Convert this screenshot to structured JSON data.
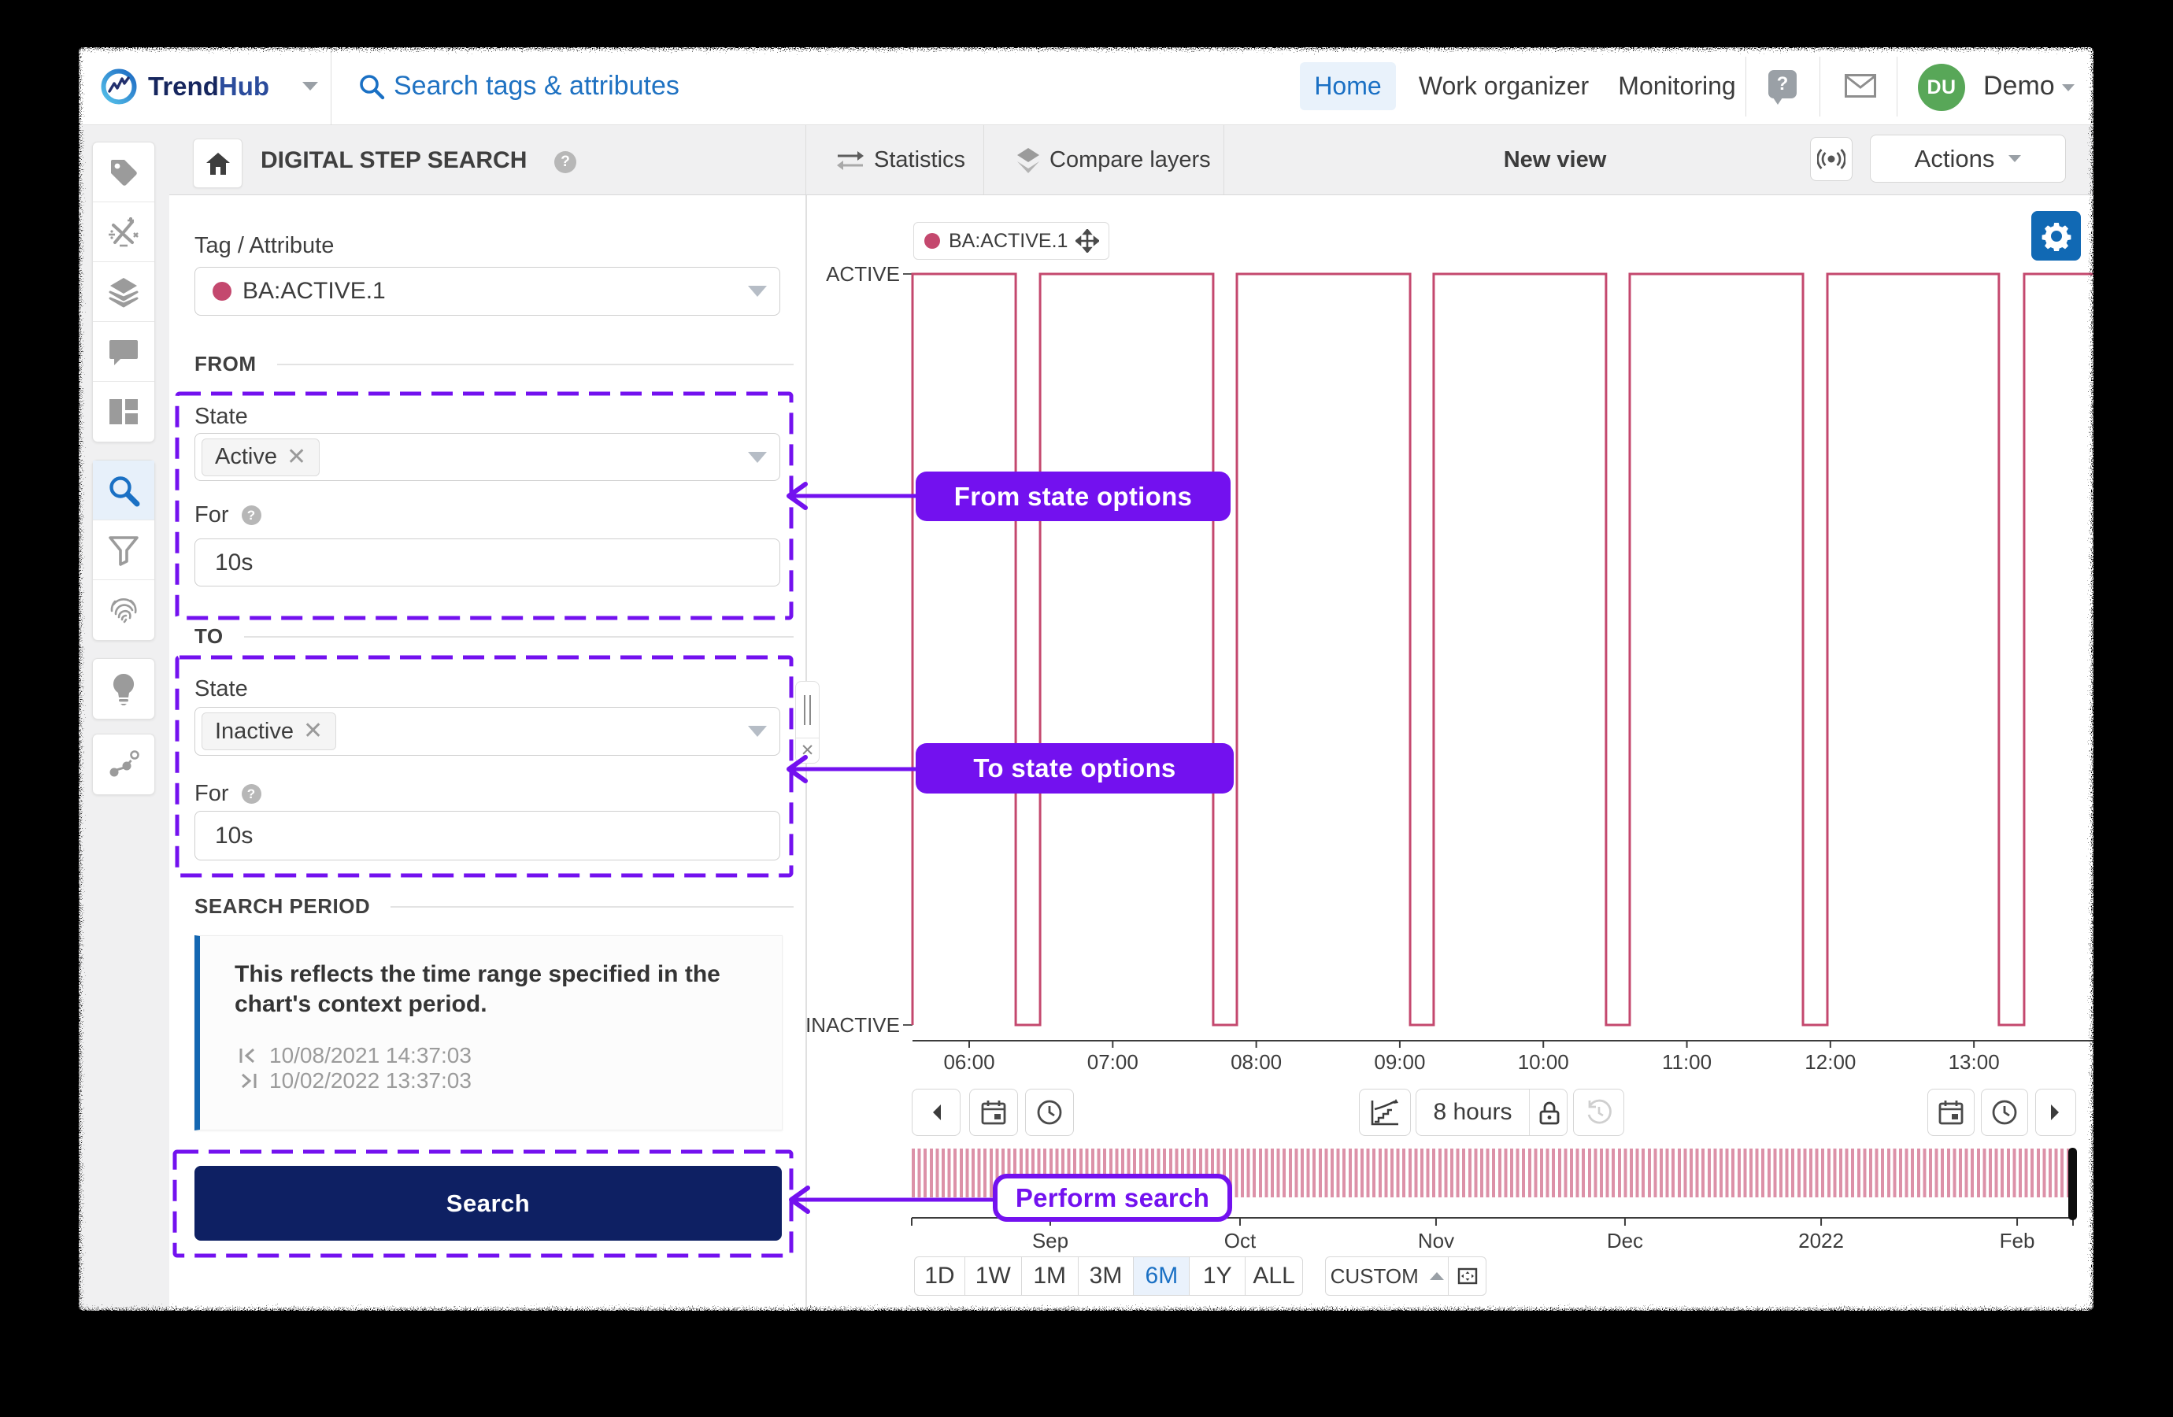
{
  "header": {
    "brand": {
      "bold": "Trend",
      "light": "Hub"
    },
    "search_placeholder": "Search tags & attributes",
    "nav": [
      {
        "label": "Home",
        "active": true
      },
      {
        "label": "Work organizer",
        "active": false
      },
      {
        "label": "Monitoring",
        "active": false
      }
    ],
    "user": {
      "initials": "DU",
      "name": "Demo"
    }
  },
  "toolbar": {
    "title": "DIGITAL STEP SEARCH",
    "statistics_label": "Statistics",
    "compare_layers_label": "Compare layers",
    "view_name": "New view",
    "actions_label": "Actions"
  },
  "sidebar": {
    "items": [
      {
        "icon": "tag"
      },
      {
        "icon": "calculation"
      },
      {
        "icon": "layers"
      },
      {
        "icon": "comment"
      },
      {
        "icon": "dashboard"
      },
      {
        "icon": "search",
        "active": true
      },
      {
        "icon": "filter"
      },
      {
        "icon": "fingerprint"
      },
      {
        "icon": "recommendation"
      },
      {
        "icon": "context-tree"
      }
    ]
  },
  "panel": {
    "tag_attribute": {
      "label": "Tag / Attribute",
      "value": "BA:ACTIVE.1",
      "color": "#c4486e"
    },
    "from": {
      "section": "FROM",
      "state_label": "State",
      "state_value": "Active",
      "for_label": "For",
      "for_value": "10s"
    },
    "to": {
      "section": "TO",
      "state_label": "State",
      "state_value": "Inactive",
      "for_label": "For",
      "for_value": "10s"
    },
    "search_period": {
      "section": "SEARCH PERIOD",
      "note_line1": "This reflects the time range specified in the",
      "note_line2": "chart's context period.",
      "start_date": "10/08/2021 14:37:03",
      "end_date": "10/02/2022 13:37:03"
    },
    "search_button": "Search"
  },
  "annotations": {
    "color": "#7311ef",
    "from_callout": "From state options",
    "to_callout": "To state options",
    "perform_callout": "Perform search"
  },
  "chart_data": {
    "type": "step",
    "series": [
      {
        "name": "BA:ACTIVE.1",
        "color": "#c4486e"
      }
    ],
    "y_states": [
      "ACTIVE",
      "INACTIVE"
    ],
    "x_range_hours": [
      5.605,
      13.833
    ],
    "active_pulses_hours": [
      [
        5.605,
        6.324
      ],
      [
        6.494,
        7.7
      ],
      [
        7.865,
        9.072
      ],
      [
        9.236,
        10.437
      ],
      [
        10.602,
        11.809
      ],
      [
        11.979,
        13.174
      ],
      [
        13.35,
        13.833
      ]
    ],
    "x_ticks": [
      "06:00",
      "07:00",
      "08:00",
      "09:00",
      "10:00",
      "11:00",
      "12:00",
      "13:00"
    ],
    "x_tick_hours": [
      6,
      7,
      8,
      9,
      10,
      11,
      12,
      13
    ],
    "context_ticks": [
      {
        "label": "Sep",
        "pos": 0.1193
      },
      {
        "label": "Oct",
        "pos": 0.2827
      },
      {
        "label": "Nov",
        "pos": 0.4515
      },
      {
        "label": "Dec",
        "pos": 0.6142
      },
      {
        "label": "2022",
        "pos": 0.7831
      },
      {
        "label": "Feb",
        "pos": 0.9519
      }
    ],
    "window_duration": "8 hours"
  },
  "zoom_controls": {
    "presets": [
      "1D",
      "1W",
      "1M",
      "3M",
      "6M",
      "1Y",
      "ALL"
    ],
    "active_preset": "6M",
    "custom_label": "CUSTOM"
  }
}
